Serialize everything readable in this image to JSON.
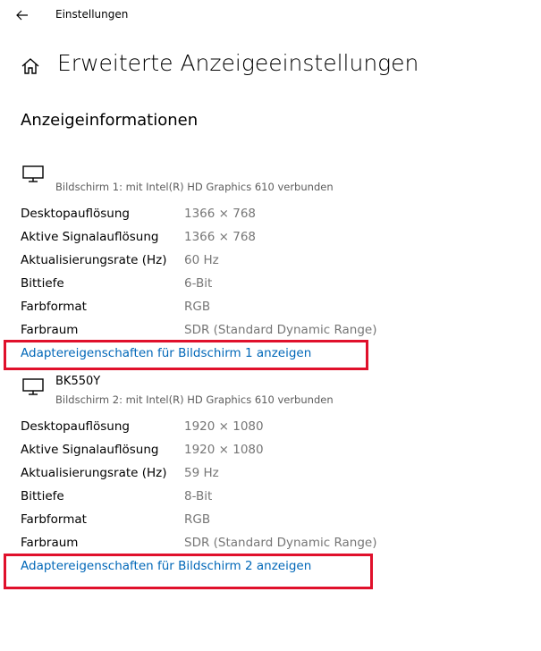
{
  "window": {
    "app_title": "Einstellungen"
  },
  "header": {
    "page_title": "Erweiterte Anzeigeeinstellungen"
  },
  "section": {
    "title": "Anzeigeinformationen"
  },
  "displays": [
    {
      "name": "",
      "subtitle": "Bildschirm 1: mit Intel(R) HD Graphics 610 verbunden",
      "rows": [
        {
          "label": "Desktopauflösung",
          "value": "1366 × 768"
        },
        {
          "label": "Aktive Signalauflösung",
          "value": "1366 × 768"
        },
        {
          "label": "Aktualisierungsrate (Hz)",
          "value": "60 Hz"
        },
        {
          "label": "Bittiefe",
          "value": "6-Bit"
        },
        {
          "label": "Farbformat",
          "value": "RGB"
        },
        {
          "label": "Farbraum",
          "value": "SDR (Standard Dynamic Range)"
        }
      ],
      "link": "Adaptereigenschaften für Bildschirm 1 anzeigen"
    },
    {
      "name": "BK550Y",
      "subtitle": "Bildschirm 2: mit Intel(R) HD Graphics 610 verbunden",
      "rows": [
        {
          "label": "Desktopauflösung",
          "value": "1920 × 1080"
        },
        {
          "label": "Aktive Signalauflösung",
          "value": "1920 × 1080"
        },
        {
          "label": "Aktualisierungsrate (Hz)",
          "value": "59 Hz"
        },
        {
          "label": "Bittiefe",
          "value": "8-Bit"
        },
        {
          "label": "Farbformat",
          "value": "RGB"
        },
        {
          "label": "Farbraum",
          "value": "SDR (Standard Dynamic Range)"
        }
      ],
      "link": "Adaptereigenschaften für Bildschirm 2 anzeigen"
    }
  ],
  "icons": {
    "back": "back-arrow-icon",
    "home": "home-icon",
    "monitor": "monitor-icon"
  },
  "colors": {
    "link": "#0067b8",
    "value_text": "#767676",
    "highlight": "#e0102b"
  }
}
